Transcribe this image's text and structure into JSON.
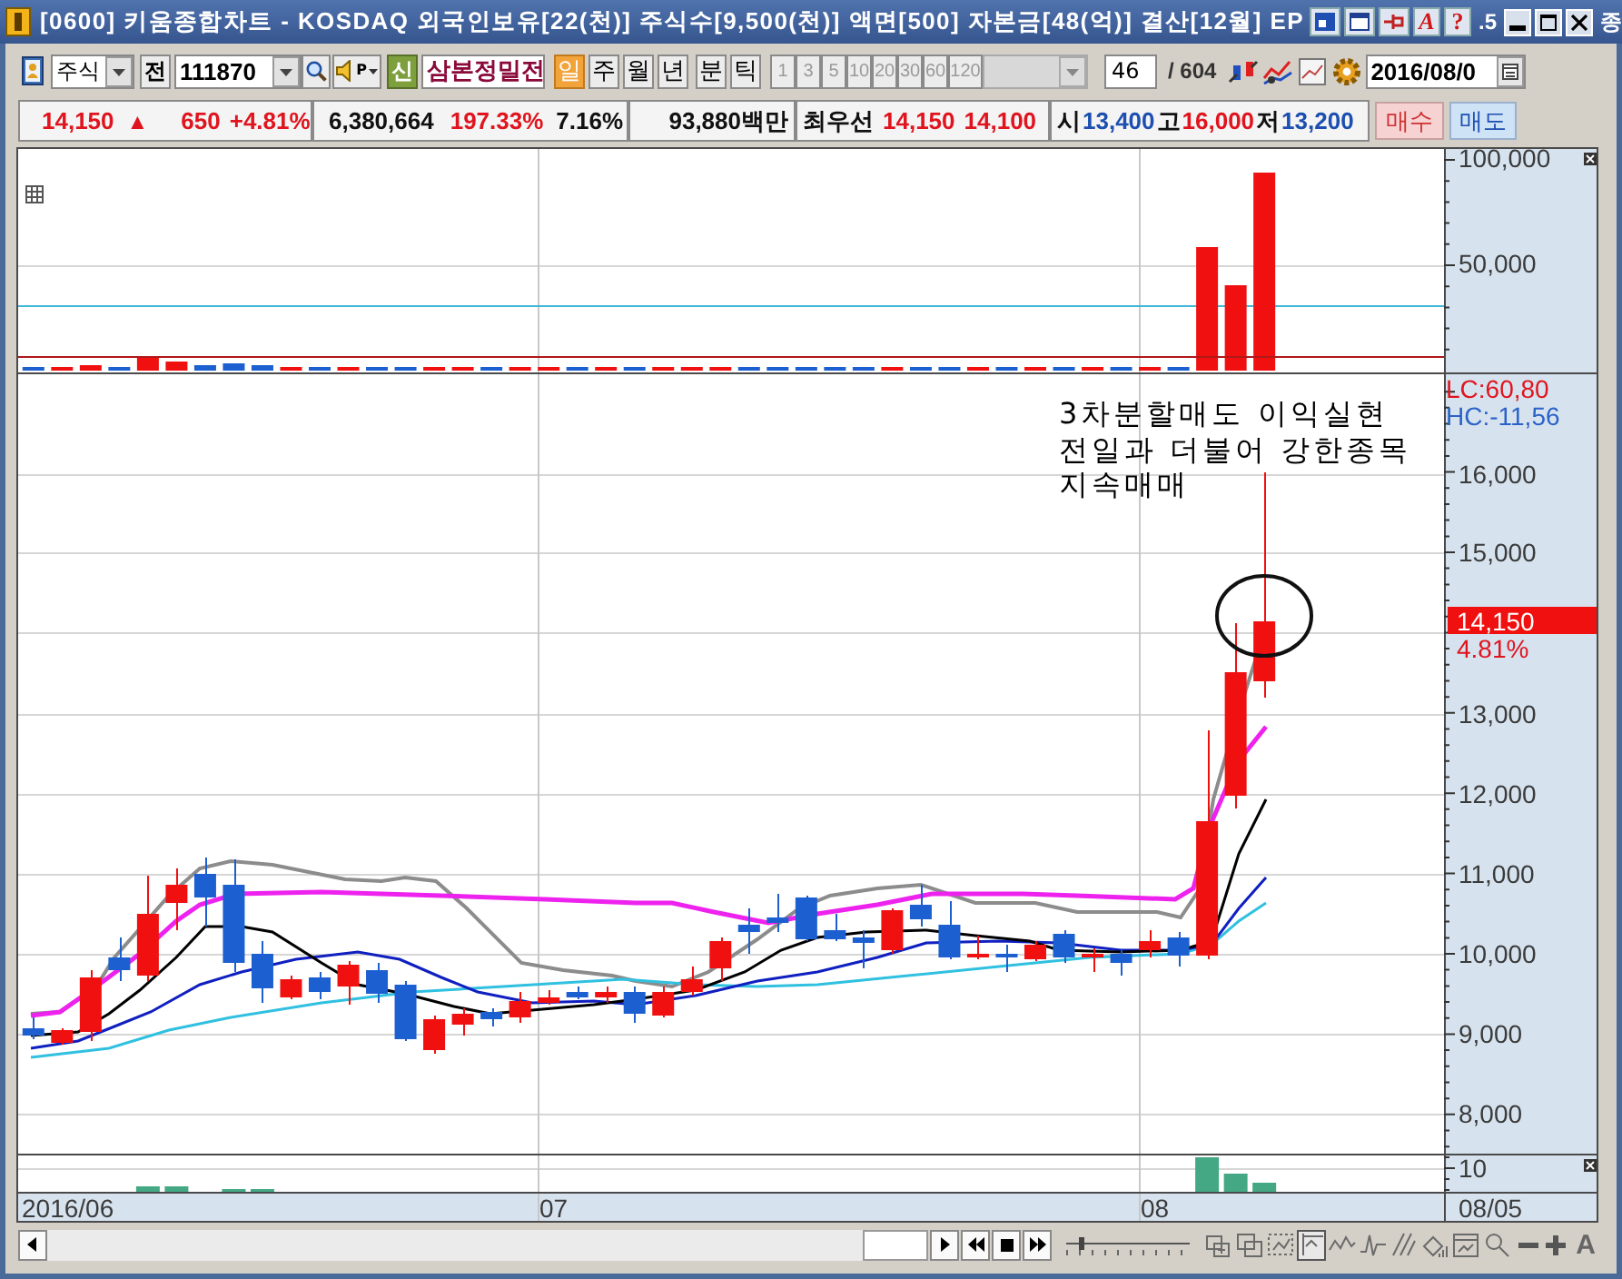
{
  "window": {
    "title": "[0600] 키움종합차트 - KOSDAQ 외국인보유[22(천)] 주식수[9,500(천)] 액면[500] 자본금[48(억)] 결산[12월] EP",
    "help_buttons": [
      "A",
      "?"
    ],
    "title_fragments": [
      ".5",
      "종"
    ]
  },
  "toolbar": {
    "market": "주식",
    "prev_button": "전",
    "code": "111870",
    "speaker_label": "P",
    "new_button": "신",
    "stock_name": "삼본정밀전",
    "periods": [
      {
        "label": "일",
        "selected": true
      },
      {
        "label": "주",
        "selected": false
      },
      {
        "label": "월",
        "selected": false
      },
      {
        "label": "년",
        "selected": false
      },
      {
        "label": "분",
        "selected": false
      },
      {
        "label": "틱",
        "selected": false
      }
    ],
    "minutes": [
      {
        "label": "1",
        "disabled": true
      },
      {
        "label": "3",
        "disabled": true
      },
      {
        "label": "5",
        "disabled": true
      },
      {
        "label": "10",
        "disabled": true
      },
      {
        "label": "20",
        "disabled": true
      },
      {
        "label": "30",
        "disabled": true
      },
      {
        "label": "60",
        "disabled": true
      },
      {
        "label": "120",
        "disabled": true
      }
    ],
    "count": "46",
    "total": "/ 604",
    "date": "2016/08/0"
  },
  "quote": {
    "price": "14,150",
    "direction": "▲",
    "change": "650",
    "change_rate": "+4.81%",
    "volume": "6,380,664",
    "volume_ratio": "197.33%",
    "turnover": "7.16%",
    "amount": "93,880백만",
    "best_label": "최우선",
    "best_ask": "14,150",
    "best_bid": "14,100",
    "open_label": "시",
    "open": "13,400",
    "high_label": "고",
    "high": "16,000",
    "low_label": "저",
    "low": "13,200",
    "buy_button": "매수",
    "sell_button": "매도"
  },
  "chart": {
    "volume_axis": [
      "100,000",
      "50,000"
    ],
    "price_axis": {
      "lc": "LC:60,80",
      "hc": "HC:-11,56",
      "labels": [
        "16,000",
        "15,000",
        "13,000",
        "12,000",
        "11,000",
        "10,000",
        "9,000",
        "8,000"
      ],
      "current_price": "14,150",
      "current_change": "4.81%"
    },
    "indicator_axis": [
      "10"
    ],
    "date_labels": [
      "2016/06",
      "07",
      "08"
    ],
    "last_date": "08/05",
    "annotation": "3차분할매도 이익실현\n전일과 더불어 강한종목\n지속매매"
  },
  "bottom_bar": {
    "zoom_slider": {
      "level": 0.1
    },
    "tools": [
      {
        "selected": false
      },
      {
        "selected": false
      },
      {
        "selected": false
      },
      {
        "selected": true
      },
      {
        "selected": false
      },
      {
        "selected": false
      },
      {
        "selected": false
      },
      {
        "selected": false
      },
      {
        "selected": false
      },
      {
        "selected": false
      }
    ],
    "font_button": "A"
  }
}
